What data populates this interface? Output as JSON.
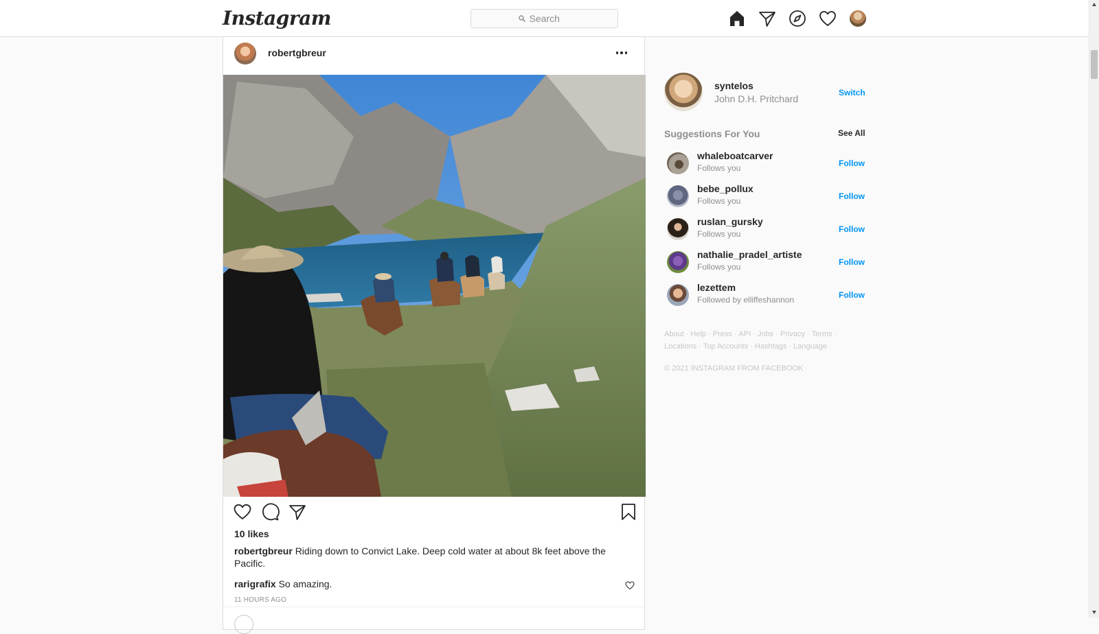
{
  "app": {
    "logo_text": "Instagram",
    "search": {
      "placeholder": "Search"
    },
    "nav_icons": [
      "home-icon",
      "direct-icon",
      "explore-icon",
      "activity-icon",
      "profile-avatar"
    ]
  },
  "post": {
    "username": "robertgbreur",
    "image_alt": "Riders on horseback descending a trail toward a blue mountain lake",
    "likes": "10 likes",
    "caption": {
      "username": "robertgbreur",
      "text": "Riding down to Convict Lake. Deep cold water at about 8k feet above the Pacific."
    },
    "comment": {
      "username": "rarigrafix",
      "text": "So amazing."
    },
    "timestamp": "11 HOURS AGO"
  },
  "sidebar": {
    "current_user": {
      "username": "syntelos",
      "full_name": "John D.H. Pritchard",
      "switch_label": "Switch"
    },
    "suggestions_title": "Suggestions For You",
    "see_all_label": "See All",
    "follow_label": "Follow",
    "suggestions": [
      {
        "username": "whaleboatcarver",
        "subtitle": "Follows you"
      },
      {
        "username": "bebe_pollux",
        "subtitle": "Follows you"
      },
      {
        "username": "ruslan_gursky",
        "subtitle": "Follows you"
      },
      {
        "username": "nathalie_pradel_artiste",
        "subtitle": "Follows you"
      },
      {
        "username": "lezettem",
        "subtitle": "Followed by elliffeshannon"
      }
    ],
    "footer_links": [
      "About",
      "Help",
      "Press",
      "API",
      "Jobs",
      "Privacy",
      "Terms",
      "Locations",
      "Top Accounts",
      "Hashtags",
      "Language"
    ],
    "copyright": "© 2021 INSTAGRAM FROM FACEBOOK"
  },
  "colors": {
    "accent": "#0095f6",
    "text": "#262626",
    "muted": "#8e8e8e",
    "border": "#dbdbdb",
    "background": "#fafafa"
  }
}
